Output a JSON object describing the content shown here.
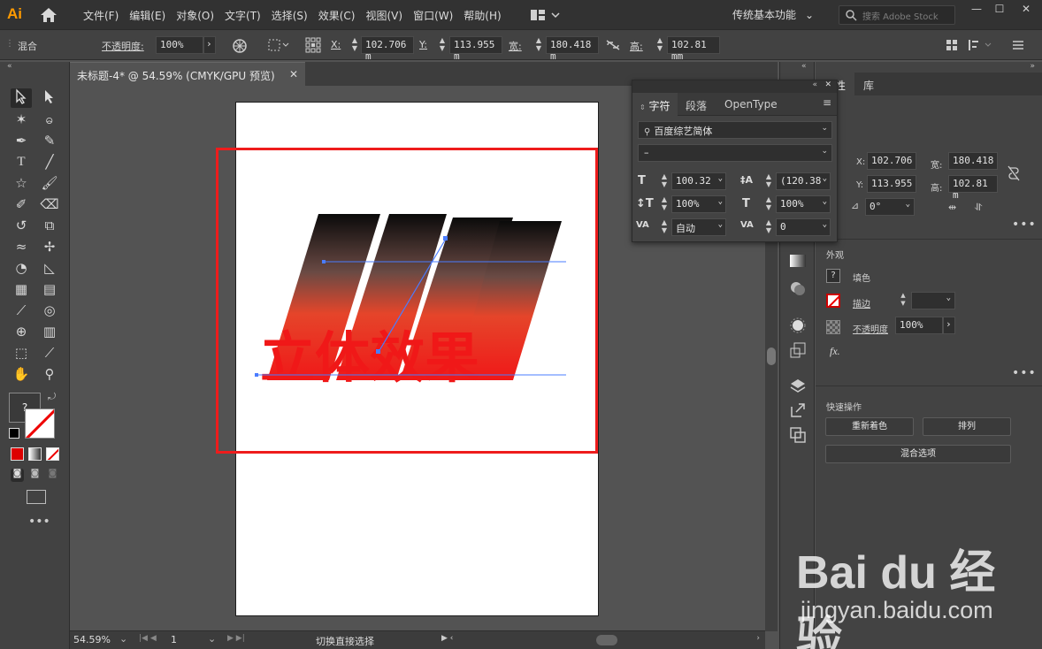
{
  "app": {
    "logo": "Ai",
    "menus": [
      "文件(F)",
      "编辑(E)",
      "对象(O)",
      "文字(T)",
      "选择(S)",
      "效果(C)",
      "视图(V)",
      "窗口(W)",
      "帮助(H)"
    ],
    "workspace": "传统基本功能",
    "search_placeholder": "搜索 Adobe Stock"
  },
  "control_bar": {
    "mode": "混合",
    "opacity_label": "不透明度",
    "opacity_value": "100%",
    "x_label": "X",
    "x_value": "102.706 m",
    "y_label": "Y",
    "y_value": "113.955 m",
    "w_label": "宽",
    "w_value": "180.418 m",
    "h_label": "高",
    "h_value": "102.81 mm"
  },
  "document": {
    "tab_title": "未标题-4* @ 54.59% (CMYK/GPU 预览)",
    "art_text": "立体效果",
    "art_color_top": "#0a0a0a",
    "art_color_bottom": "#f01818"
  },
  "status": {
    "zoom": "54.59%",
    "artboard": "1",
    "tool_hint": "切换直接选择"
  },
  "properties": {
    "tabs": [
      "属性",
      "库"
    ],
    "x_label": "X:",
    "x_value": "102.706",
    "y_label": "Y:",
    "y_value": "113.955",
    "w_label": "宽:",
    "w_value": "180.418",
    "h_label": "高:",
    "h_value": "102.81 m",
    "angle_value": "0°",
    "appearance_title": "外观",
    "fill_label": "填色",
    "stroke_label": "描边",
    "opacity_label": "不透明度",
    "opacity_value": "100%",
    "fx_label": "fx.",
    "quick_title": "快速操作",
    "recolor_btn": "重新着色",
    "arrange_btn": "排列",
    "blend_btn": "混合选项"
  },
  "character_panel": {
    "tabs": [
      "字符",
      "段落",
      "OpenType"
    ],
    "font_family": "百度综艺简体",
    "font_style": "–",
    "size": "100.32",
    "leading": "(120.38",
    "vscale": "100%",
    "hscale": "100%",
    "kerning": "自动",
    "tracking": "0"
  },
  "watermark": {
    "logo": "Bai du 经验",
    "url": "jingyan.baidu.com"
  }
}
